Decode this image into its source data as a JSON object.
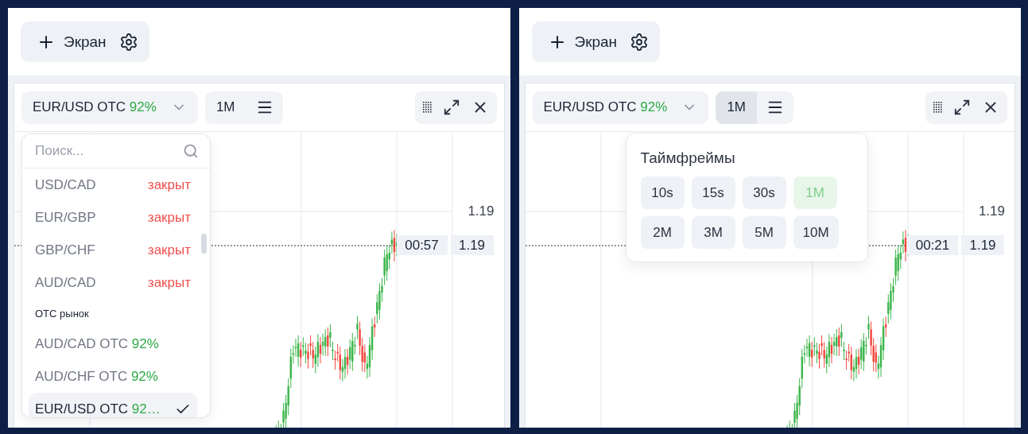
{
  "panels": [
    {
      "add_button": "Экран",
      "asset": {
        "name": "EUR/USD OTC",
        "payout": "92%"
      },
      "timeframe": {
        "label": "1M",
        "selected": false
      },
      "axis_price": "1.19",
      "timer": "00:57",
      "current_price": "1.19",
      "popup": {
        "kind": "asset_list",
        "search_placeholder": "Поиск...",
        "items": [
          {
            "kind": "asset",
            "name": "USD/CAD",
            "status": "закрыт",
            "selected": false
          },
          {
            "kind": "asset",
            "name": "EUR/GBP",
            "status": "закрыт",
            "selected": false
          },
          {
            "kind": "asset",
            "name": "GBP/CHF",
            "status": "закрыт",
            "selected": false
          },
          {
            "kind": "asset",
            "name": "AUD/CAD",
            "status": "закрыт",
            "selected": false
          },
          {
            "kind": "header",
            "label": "OTC рынок"
          },
          {
            "kind": "asset",
            "name": "AUD/CAD OTC",
            "payout": "92%",
            "selected": false
          },
          {
            "kind": "asset",
            "name": "AUD/CHF OTC",
            "payout": "92%",
            "selected": false
          },
          {
            "kind": "asset",
            "name": "EUR/USD OTC",
            "payout": "92…",
            "selected": true
          }
        ]
      }
    },
    {
      "add_button": "Экран",
      "asset": {
        "name": "EUR/USD OTC",
        "payout": "92%"
      },
      "timeframe": {
        "label": "1M",
        "selected": true
      },
      "axis_price": "1.19",
      "timer": "00:21",
      "current_price": "1.19",
      "popup": {
        "kind": "timeframes",
        "title": "Таймфреймы",
        "rows": [
          [
            {
              "label": "10s",
              "selected": false
            },
            {
              "label": "15s",
              "selected": false
            },
            {
              "label": "30s",
              "selected": false
            },
            {
              "label": "1M",
              "selected": true
            }
          ],
          [
            {
              "label": "2M",
              "selected": false
            },
            {
              "label": "3M",
              "selected": false
            },
            {
              "label": "5M",
              "selected": false
            },
            {
              "label": "10M",
              "selected": false
            }
          ]
        ]
      }
    }
  ]
}
